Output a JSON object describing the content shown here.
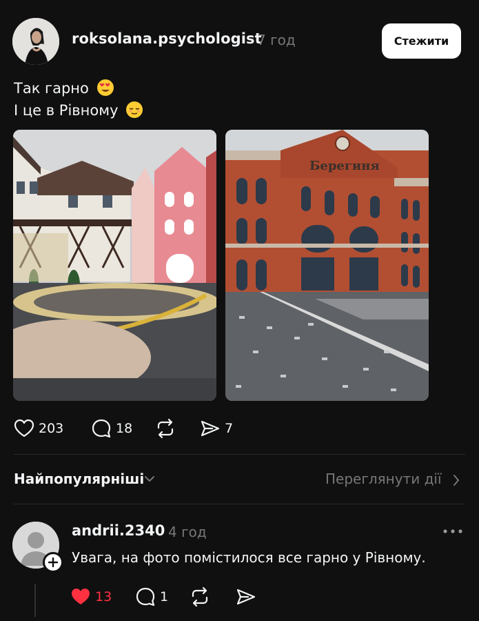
{
  "post": {
    "username": "roksolana.psychologist",
    "time": "7 год",
    "follow_label": "Стежити",
    "caption_line1": "Так гарно",
    "caption_line2": "І це в Рівному",
    "caption_emoji1": "heart-eyes-emoji",
    "caption_emoji2": "relieved-emoji",
    "likes": "203",
    "replies": "18",
    "shares": "7",
    "photo2_sign": "Берегиня"
  },
  "sort": {
    "label": "Найпопулярніші",
    "view_activity": "Переглянути дії"
  },
  "comment": {
    "username": "andrii.2340",
    "time": "4 год",
    "text": "Увага, на фото помістилося все гарно у Рівному.",
    "likes": "13",
    "replies": "1",
    "liked": true
  },
  "colors": {
    "background": "#101010",
    "text": "#f3f5f7",
    "muted": "#777777",
    "like_red": "#ff3040",
    "follow_bg": "#ffffff"
  }
}
